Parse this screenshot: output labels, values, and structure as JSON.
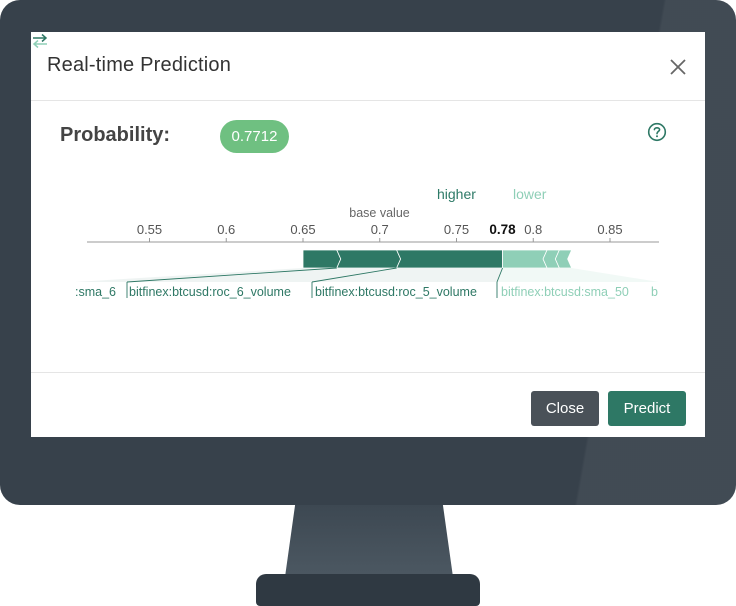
{
  "dialog": {
    "title": "Real-time Prediction",
    "probability_label": "Probability:",
    "probability_value": "0.7712"
  },
  "legend": {
    "higher": "higher",
    "lower": "lower"
  },
  "chart_data": {
    "type": "force_plot",
    "base_value_label": "base value",
    "output_value": 0.78,
    "output_label": "0.78",
    "axis": {
      "ticks": [
        {
          "value": 0.55,
          "label": "0.55"
        },
        {
          "value": 0.6,
          "label": "0.6"
        },
        {
          "value": 0.65,
          "label": "0.65"
        },
        {
          "value": 0.7,
          "label": "0.7"
        },
        {
          "value": 0.75,
          "label": "0.75"
        },
        {
          "value": 0.8,
          "label": "0.8"
        },
        {
          "value": 0.85,
          "label": "0.85"
        }
      ],
      "range": [
        0.508,
        0.88
      ]
    },
    "positive_segments": [
      {
        "from": 0.65,
        "to": 0.672
      },
      {
        "from": 0.672,
        "to": 0.711
      },
      {
        "from": 0.711,
        "to": 0.78
      }
    ],
    "negative_segments": [
      {
        "from": 0.78,
        "to": 0.809
      },
      {
        "from": 0.809,
        "to": 0.817
      },
      {
        "from": 0.817,
        "to": 0.825
      }
    ],
    "feature_labels": [
      {
        "name": "",
        "value": ":sma_6",
        "side": "higher"
      },
      {
        "name": "",
        "value": "bitfinex:btcusd:roc_6_volume",
        "side": "higher"
      },
      {
        "name": "",
        "value": "bitfinex:btcusd:roc_5_volume",
        "side": "higher"
      },
      {
        "name": "",
        "value": "bitfinex:btcusd:sma_50",
        "side": "lower"
      },
      {
        "name": "",
        "value": "b",
        "side": "lower"
      }
    ],
    "colors": {
      "higher": "#2e7865",
      "lower": "#8fcfb7",
      "axis": "#999999"
    }
  },
  "buttons": {
    "close": "Close",
    "predict": "Predict"
  },
  "icons": {
    "close": "close-icon",
    "help": "help-circle-icon",
    "swap": "swap-arrows-icon"
  }
}
